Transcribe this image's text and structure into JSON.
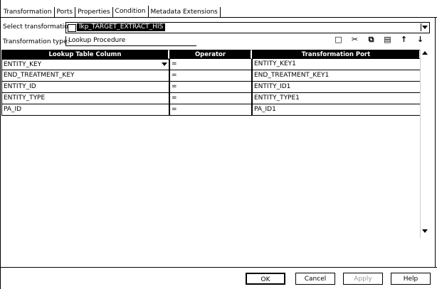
{
  "tabs": [
    "Transformation",
    "Ports",
    "Properties",
    "Condition",
    "Metadata Extensions"
  ],
  "active_tab": "Condition",
  "select_transformation": {
    "label": "Select transformation:",
    "value": "lkp_TARGET_EXTRACT_HIS"
  },
  "transformation_type": {
    "label": "Transformation type:",
    "value": "Lookup Procedure"
  },
  "toolbar": [
    "new-icon",
    "cut-icon",
    "copy-icon",
    "paste-icon",
    "move-up-icon",
    "move-down-icon"
  ],
  "grid": {
    "headers": [
      "Lookup Table Column",
      "Operator",
      "Transformation Port"
    ],
    "rows": [
      {
        "lookup": "ENTITY_KEY",
        "op": "=",
        "port": "ENTITY_KEY1"
      },
      {
        "lookup": "END_TREATMENT_KEY",
        "op": "=",
        "port": "END_TREATMENT_KEY1"
      },
      {
        "lookup": "ENTITY_ID",
        "op": "=",
        "port": "ENTITY_ID1"
      },
      {
        "lookup": "ENTITY_TYPE",
        "op": "=",
        "port": "ENTITY_TYPE1"
      },
      {
        "lookup": "PA_ID",
        "op": "=",
        "port": "PA_ID1"
      }
    ]
  },
  "buttons": {
    "ok": "OK",
    "cancel": "Cancel",
    "apply": "Apply",
    "help": "Help"
  }
}
